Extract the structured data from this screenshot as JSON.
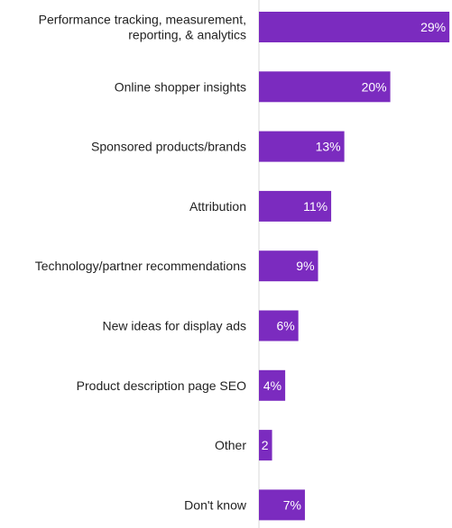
{
  "chart_data": {
    "type": "bar",
    "orientation": "horizontal",
    "categories": [
      [
        "Performance tracking, measurement,",
        "reporting, & analytics"
      ],
      [
        "Online shopper insights"
      ],
      [
        "Sponsored products/brands"
      ],
      [
        "Attribution"
      ],
      [
        "Technology/partner recommendations"
      ],
      [
        "New ideas for display ads"
      ],
      [
        "Product description page SEO"
      ],
      [
        "Other"
      ],
      [
        "Don't know"
      ]
    ],
    "values": [
      29,
      20,
      13,
      11,
      9,
      6,
      4,
      2,
      7
    ],
    "value_labels": [
      "29%",
      "20%",
      "13%",
      "11%",
      "9%",
      "6%",
      "4%",
      "2",
      "7%"
    ],
    "xlim": [
      0,
      30
    ],
    "grid": false,
    "bar_color": "#7b2bbf",
    "axis_color": "#d9d9d9",
    "label_color": "#222222",
    "value_label_color": "#ffffff"
  }
}
